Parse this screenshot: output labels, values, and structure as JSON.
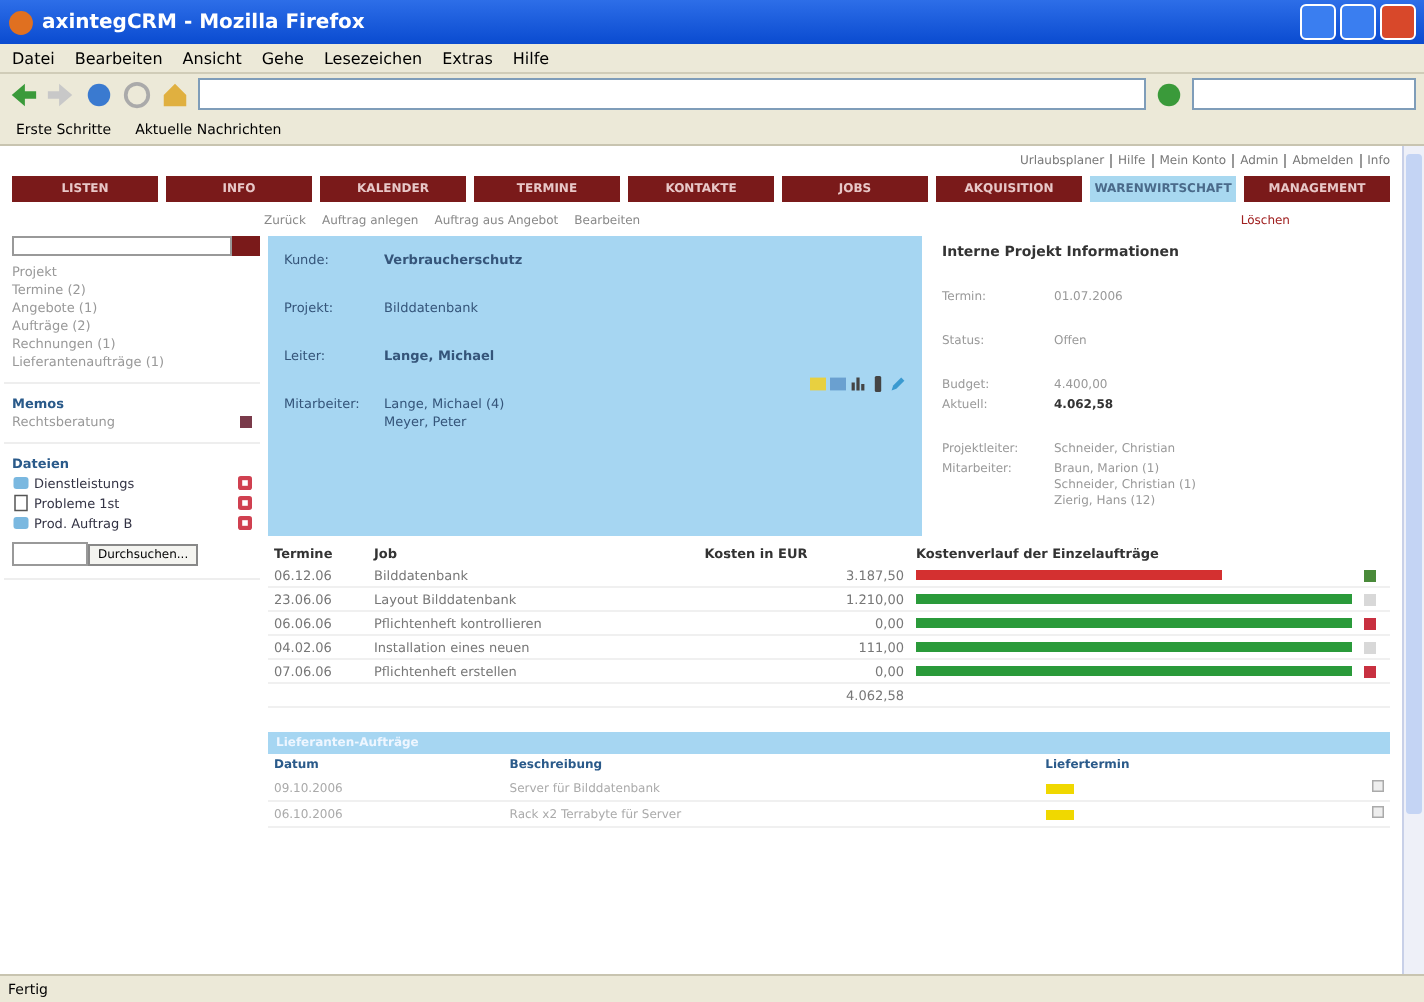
{
  "window": {
    "title": "axintegCRM - Mozilla Firefox"
  },
  "menu": [
    "Datei",
    "Bearbeiten",
    "Ansicht",
    "Gehe",
    "Lesezeichen",
    "Extras",
    "Hilfe"
  ],
  "bookmarks": [
    "Erste Schritte",
    "Aktuelle Nachrichten"
  ],
  "top_links": [
    "Urlaubsplaner",
    "Hilfe",
    "Mein Konto",
    "Admin",
    "Abmelden",
    "Info"
  ],
  "nav": [
    {
      "label": "LISTEN",
      "selected": false
    },
    {
      "label": "INFO",
      "selected": false
    },
    {
      "label": "KALENDER",
      "selected": false
    },
    {
      "label": "TERMINE",
      "selected": false
    },
    {
      "label": "KONTAKTE",
      "selected": false
    },
    {
      "label": "JOBS",
      "selected": false
    },
    {
      "label": "AKQUISITION",
      "selected": false
    },
    {
      "label": "WARENWIRTSCHAFT",
      "selected": true
    },
    {
      "label": "MANAGEMENT",
      "selected": false
    }
  ],
  "subnav": {
    "actions": [
      "Zurück",
      "Auftrag anlegen",
      "Auftrag aus Angebot",
      "Bearbeiten"
    ],
    "delete": "Löschen"
  },
  "sidebar": {
    "links": [
      "Projekt",
      "Termine (2)",
      "Angebote (1)",
      "Aufträge (2)",
      "Rechnungen (1)",
      "Lieferantenaufträge (1)"
    ],
    "memos_title": "Memos",
    "memos": [
      "Rechtsberatung"
    ],
    "files_title": "Dateien",
    "files": [
      {
        "name": "Dienstleistungs",
        "kind": "doc"
      },
      {
        "name": "Probleme 1st",
        "kind": "text"
      },
      {
        "name": "Prod. Auftrag B",
        "kind": "doc"
      }
    ],
    "browse": "Durchsuchen..."
  },
  "project": [
    {
      "label": "Kunde:",
      "values": [
        "Verbraucherschutz"
      ],
      "bold": true
    },
    {
      "label": "Projekt:",
      "values": [
        "Bilddatenbank"
      ],
      "bold": false
    },
    {
      "label": "Leiter:",
      "values": [
        "Lange, Michael"
      ],
      "bold": true
    },
    {
      "label": "Mitarbeiter:",
      "values": [
        "Lange, Michael (4)",
        "Meyer, Peter"
      ],
      "bold": false
    }
  ],
  "internal": {
    "title": "Interne Projekt Informationen",
    "groups": [
      [
        {
          "label": "Termin:",
          "values": [
            "01.07.2006"
          ],
          "bold": false
        }
      ],
      [
        {
          "label": "Status:",
          "values": [
            "Offen"
          ],
          "bold": false
        }
      ],
      [
        {
          "label": "Budget:",
          "values": [
            "4.400,00"
          ],
          "bold": false
        },
        {
          "label": "Aktuell:",
          "values": [
            "4.062,58"
          ],
          "bold": true
        }
      ],
      [
        {
          "label": "Projektleiter:",
          "values": [
            "Schneider, Christian"
          ],
          "bold": false
        },
        {
          "label": "Mitarbeiter:",
          "values": [
            "Braun, Marion (1)",
            "Schneider, Christian (1)",
            "Zierig, Hans (12)"
          ],
          "bold": false
        }
      ]
    ]
  },
  "jobs": {
    "columns": [
      "Termine",
      "Job",
      "Kosten in EUR",
      "Kostenverlauf der Einzelaufträge"
    ],
    "rows": [
      {
        "date": "06.12.06",
        "job": "Bilddatenbank",
        "cost": "3.187,50",
        "level": 0.7,
        "over_budget": true,
        "color": "#4a8a3a"
      },
      {
        "date": "23.06.06",
        "job": "Layout Bilddatenbank",
        "cost": "1.210,00",
        "level": 1,
        "over_budget": false,
        "color": "#d8d8d8"
      },
      {
        "date": "06.06.06",
        "job": "Pflichtenheft kontrollieren",
        "cost": "0,00",
        "level": 1,
        "over_budget": false,
        "color": "#c83040"
      },
      {
        "date": "04.02.06",
        "job": "Installation eines neuen",
        "cost": "111,00",
        "level": 1,
        "over_budget": false,
        "color": "#d8d8d8"
      },
      {
        "date": "07.06.06",
        "job": "Pflichtenheft erstellen",
        "cost": "0,00",
        "level": 1,
        "over_budget": false,
        "color": "#c83040"
      }
    ],
    "total": "4.062,58"
  },
  "suppliers": {
    "title": "Lieferanten-Aufträge",
    "columns": [
      "Datum",
      "Beschreibung",
      "Liefertermin"
    ],
    "rows": [
      {
        "date": "09.10.2006",
        "description": "Server für Bilddatenbank"
      },
      {
        "date": "06.10.2006",
        "description": "Rack x2 Terrabyte für Server"
      }
    ]
  },
  "status_bar": "Fertig"
}
